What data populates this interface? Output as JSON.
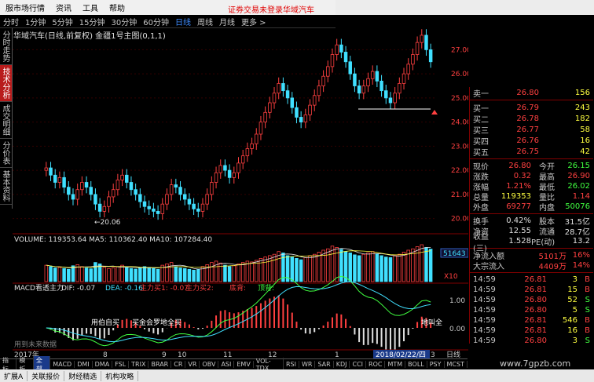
{
  "menu": {
    "items": [
      "服市场行情",
      "资讯",
      "工具",
      "帮助"
    ],
    "login_warning": "证券交易未登录",
    "stock_tab": "华域汽车"
  },
  "periods": {
    "items": [
      "分时",
      "1分钟",
      "5分钟",
      "15分钟",
      "30分钟",
      "60分钟",
      "日线",
      "周线",
      "月线",
      "更多 >"
    ],
    "active": "日线"
  },
  "side_tabs": [
    "分时走势",
    "技术分析",
    "成交明细",
    "分价表",
    "基本资料"
  ],
  "chart": {
    "title": "华域汽车(日线,前复权) 金疆1号主图(0,1,1)",
    "low_label": "←20.06",
    "price_axis": [
      "27.00",
      "26.00",
      "25.00",
      "24.00",
      "23.00",
      "22.00",
      "21.00",
      "20.00"
    ],
    "volume_title": "VOLUME: 119353.64  MA5: 110362.40  MA10: 107284.40",
    "volume_axis": [
      "51643",
      "X10"
    ],
    "macd_title": "MACD看透主力",
    "macd_dif": "DIF: -0.07",
    "macd_dea": "DEA: -0.16",
    "macd_buy1": "主力买1: -0.07",
    "macd_buy2": "主力买2:",
    "macd_bottom": "底背:",
    "macd_top": "顶背:",
    "macd_axis": [
      "1.00",
      "0.00"
    ],
    "macd_note1": "用伯自买",
    "macd_note2": "买金会罗地全买",
    "macd_note3": "地叫全",
    "footer_note": "用到未来数据",
    "date_axis": [
      "2017年",
      "8",
      "9",
      "10",
      "11",
      "12",
      "1",
      "2",
      "3"
    ],
    "date_badge": "2018/02/22/四",
    "period_label": "日线"
  },
  "chart_data": {
    "type": "candlestick",
    "ylim": [
      19.5,
      27.5
    ],
    "close": [
      22.1,
      21.8,
      21.5,
      21.7,
      21.3,
      21.0,
      20.8,
      21.2,
      21.5,
      21.3,
      21.0,
      20.6,
      20.3,
      20.5,
      20.9,
      21.2,
      21.6,
      21.8,
      21.5,
      21.2,
      21.0,
      20.7,
      20.5,
      20.4,
      20.3,
      20.2,
      20.6,
      21.0,
      21.4,
      21.3,
      21.0,
      20.8,
      20.6,
      20.4,
      20.3,
      20.6,
      21.0,
      21.5,
      21.9,
      22.2,
      22.0,
      21.7,
      21.9,
      22.3,
      22.6,
      22.9,
      23.1,
      23.5,
      24.0,
      24.4,
      24.8,
      25.2,
      25.6,
      25.3,
      25.0,
      24.6,
      24.2,
      24.0,
      24.3,
      24.7,
      25.1,
      25.5,
      25.9,
      26.3,
      26.8,
      27.2,
      26.9,
      26.5,
      26.0,
      25.5,
      25.2,
      25.5,
      25.8,
      26.1,
      25.7,
      25.3,
      25.0,
      24.8,
      25.2,
      25.6,
      26.0,
      26.4,
      26.8,
      27.3,
      27.6,
      27.0,
      26.5
    ],
    "volume": [
      60,
      55,
      50,
      52,
      48,
      45,
      58,
      62,
      55,
      50,
      47,
      70,
      65,
      52,
      48,
      50,
      55,
      60,
      52,
      48,
      46,
      50,
      55,
      52,
      48,
      45,
      60,
      65,
      70,
      55,
      50,
      48,
      45,
      42,
      44,
      55,
      62,
      70,
      75,
      68,
      60,
      55,
      58,
      65,
      70,
      75,
      72,
      78,
      85,
      90,
      95,
      100,
      110,
      105,
      95,
      90,
      85,
      80,
      88,
      95,
      100,
      108,
      115,
      120,
      130,
      125,
      118,
      110,
      105,
      98,
      95,
      100,
      105,
      110,
      102,
      95,
      90,
      88,
      95,
      100,
      108,
      115,
      120,
      128,
      135,
      125,
      119
    ]
  },
  "order_book": {
    "asks": [
      {
        "label": "卖一",
        "price": "26.80",
        "vol": "156"
      }
    ],
    "bids": [
      {
        "label": "买一",
        "price": "26.79",
        "vol": "243"
      },
      {
        "label": "买二",
        "price": "26.78",
        "vol": "182"
      },
      {
        "label": "买三",
        "price": "26.77",
        "vol": "58"
      },
      {
        "label": "买四",
        "price": "26.76",
        "vol": "16"
      },
      {
        "label": "买五",
        "price": "26.75",
        "vol": "42"
      }
    ]
  },
  "quote": [
    {
      "l": "现价",
      "v": "26.80",
      "vc": "red",
      "l2": "今开",
      "v2": "26.15",
      "v2c": "green"
    },
    {
      "l": "涨跌",
      "v": "0.32",
      "vc": "red",
      "l2": "最高",
      "v2": "26.90",
      "v2c": "red"
    },
    {
      "l": "涨幅",
      "v": "1.21%",
      "vc": "red",
      "l2": "最低",
      "v2": "26.02",
      "v2c": "green"
    },
    {
      "l": "总量",
      "v": "119353",
      "vc": "yellow",
      "l2": "量比",
      "v2": "1.14",
      "v2c": "red"
    },
    {
      "l": "外盘",
      "v": "69277",
      "vc": "red",
      "l2": "内盘",
      "v2": "50076",
      "v2c": "green"
    }
  ],
  "fundamentals": [
    {
      "l": "换手",
      "v": "0.42%",
      "l2": "股本",
      "v2": "31.5亿"
    },
    {
      "l": "净资",
      "v": "12.55",
      "l2": "流通",
      "v2": "28.7亿"
    },
    {
      "l": "收益(三)",
      "v": "1.528",
      "l2": "PE(动)",
      "v2": "13.2"
    }
  ],
  "flows": [
    {
      "l": "净流入额",
      "v": "5101万",
      "p": "16%"
    },
    {
      "l": "大宗流入",
      "v": "4409万",
      "p": "14%"
    }
  ],
  "ticks": [
    {
      "t": "14:59",
      "p": "26.81",
      "pc": "red",
      "v": "3",
      "bs": "B",
      "bsc": "red"
    },
    {
      "t": "14:59",
      "p": "26.81",
      "pc": "red",
      "v": "15",
      "bs": "B",
      "bsc": "red"
    },
    {
      "t": "14:59",
      "p": "26.80",
      "pc": "red",
      "v": "52",
      "bs": "S",
      "bsc": "green"
    },
    {
      "t": "14:59",
      "p": "26.80",
      "pc": "red",
      "v": "5",
      "bs": "S",
      "bsc": "green"
    },
    {
      "t": "14:59",
      "p": "26.81",
      "pc": "red",
      "v": "546",
      "bs": "B",
      "bsc": "red"
    },
    {
      "t": "14:59",
      "p": "26.81",
      "pc": "red",
      "v": "16",
      "bs": "B",
      "bsc": "red"
    },
    {
      "t": "14:59",
      "p": "26.80",
      "pc": "red",
      "v": "3",
      "bs": "S",
      "bsc": "green"
    }
  ],
  "indicator_tabs": [
    "指标",
    "模板",
    "全部",
    "MACD",
    "DMI",
    "DMA",
    "FSL",
    "TRIX",
    "BRAR",
    "CR",
    "VR",
    "OBV",
    "ASI",
    "EMV",
    "VOL-TDX",
    "RSI",
    "WR",
    "SAR",
    "KDJ",
    "CCI",
    "ROC",
    "MTM",
    "BOLL",
    "PSY",
    "MCST"
  ],
  "indicator_active": "全部",
  "status_items": [
    "扩展A",
    "关联报价",
    "财经精选",
    "机构攻略"
  ],
  "watermark": "www.7gpzb.com",
  "colors": {
    "up": "#ff4040",
    "down": "#40e0ff",
    "accent": "#3e8cff",
    "panel_border": "#800000"
  }
}
